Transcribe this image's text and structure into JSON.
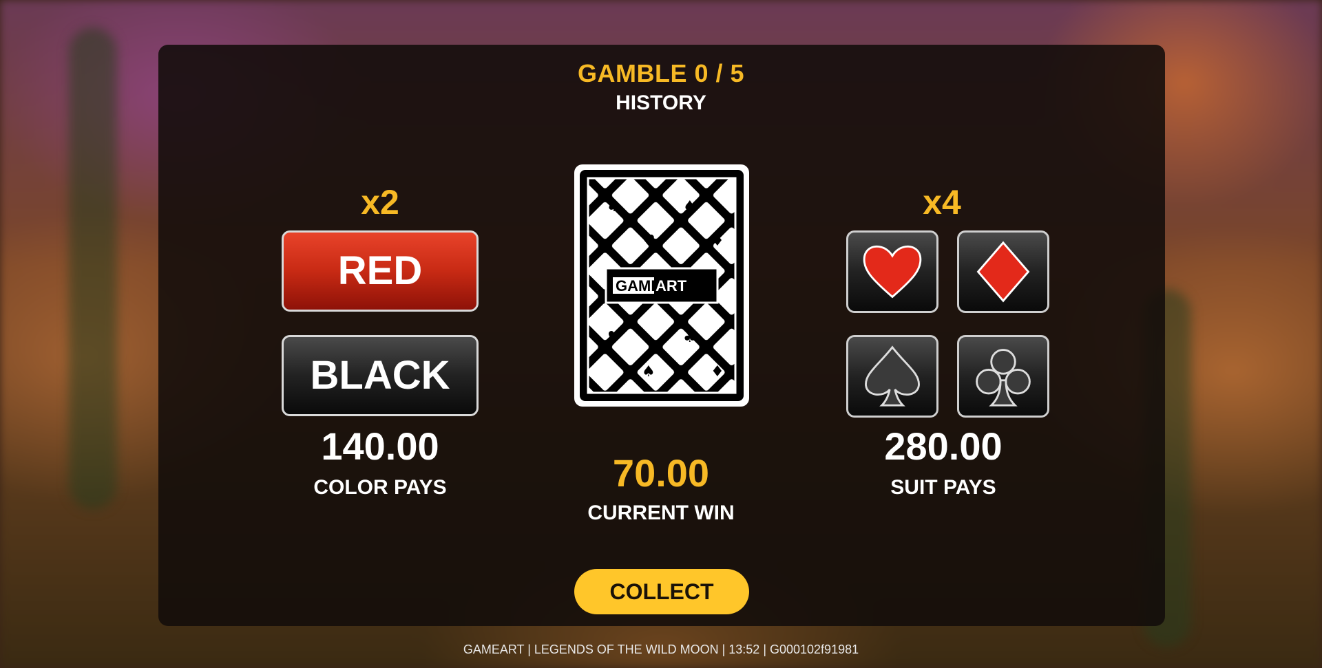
{
  "header": {
    "gamble": "GAMBLE 0 / 5",
    "history": "HISTORY"
  },
  "color_side": {
    "multiplier": "x2",
    "red_label": "RED",
    "black_label": "BLACK",
    "pays_amount": "140.00",
    "pays_label": "COLOR PAYS"
  },
  "card": {
    "brand": "GAMEART",
    "brand_part1": "GAME",
    "brand_part2": "ART"
  },
  "center": {
    "current_win_amount": "70.00",
    "current_win_label": "CURRENT WIN",
    "collect_label": "COLLECT"
  },
  "suit_side": {
    "multiplier": "x4",
    "suits": [
      "hearts",
      "diamonds",
      "spades",
      "clubs"
    ],
    "pays_amount": "280.00",
    "pays_label": "SUIT PAYS"
  },
  "footer": "GAMEART | LEGENDS OF THE WILD MOON | 13:52 | G000102f91981",
  "colors": {
    "accent_yellow": "#f7b925",
    "red": "#d8321c",
    "collect_yellow": "#ffc62a"
  }
}
